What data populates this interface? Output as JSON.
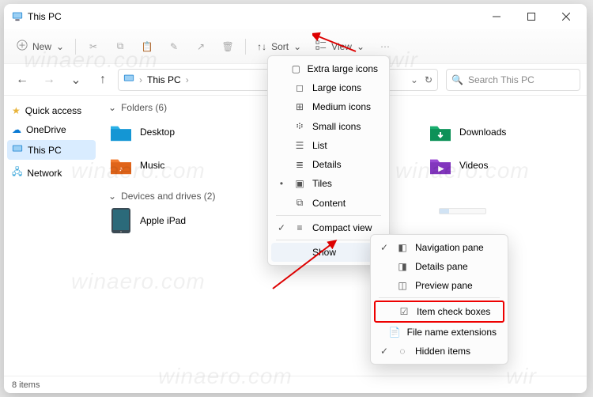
{
  "window": {
    "title": "This PC"
  },
  "toolbar": {
    "new": "New",
    "sort": "Sort",
    "view": "View"
  },
  "address": {
    "path": "This PC",
    "chevron": "›"
  },
  "search": {
    "placeholder": "Search This PC"
  },
  "sidebar": {
    "items": [
      {
        "label": "Quick access"
      },
      {
        "label": "OneDrive"
      },
      {
        "label": "This PC"
      },
      {
        "label": "Network"
      }
    ]
  },
  "content": {
    "folders_hdr": "Folders (6)",
    "devices_hdr": "Devices and drives (2)",
    "folders": {
      "desktop": "Desktop",
      "music": "Music",
      "downloads": "Downloads",
      "videos": "Videos"
    },
    "devices": {
      "ipad": "Apple iPad"
    }
  },
  "view_menu": {
    "items": [
      "Extra large icons",
      "Large icons",
      "Medium icons",
      "Small icons",
      "List",
      "Details",
      "Tiles",
      "Content",
      "Compact view",
      "Show"
    ]
  },
  "show_submenu": {
    "items": [
      "Navigation pane",
      "Details pane",
      "Preview pane",
      "Item check boxes",
      "File name extensions",
      "Hidden items"
    ]
  },
  "status": {
    "text": "8 items"
  }
}
